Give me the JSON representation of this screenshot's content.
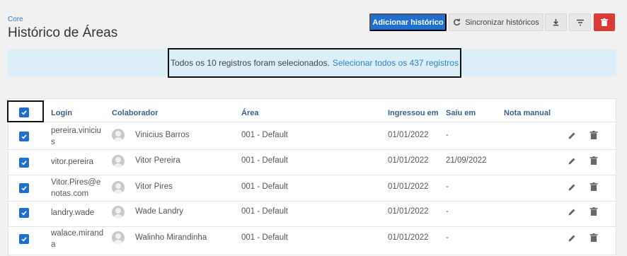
{
  "breadcrumb": "Core",
  "page_title": "Histórico de Áreas",
  "toolbar": {
    "add_label": "Adicionar histórico",
    "sync_label": "Sincronizar históricos"
  },
  "banner": {
    "message": "Todos os 10 registros foram selecionados.",
    "link": "Selecionar todos os 437 registros"
  },
  "table": {
    "headers": {
      "login": "Login",
      "colaborador": "Colaborador",
      "area": "Área",
      "ingressou": "Ingressou em",
      "saiu": "Saiu em",
      "nota": "Nota manual"
    },
    "rows": [
      {
        "login": "pereira.vinicius",
        "colaborador": "Vinicius Barros",
        "area": "001 - Default",
        "ingressou": "01/01/2022",
        "saiu": "-",
        "selected": true
      },
      {
        "login": "vitor.pereira",
        "colaborador": "Vitor Pereira",
        "area": "001 - Default",
        "ingressou": "01/01/2022",
        "saiu": "21/09/2022",
        "selected": true
      },
      {
        "login": "Vitor.Pires@enotas.com",
        "colaborador": "Vitor Pires",
        "area": "001 - Default",
        "ingressou": "01/01/2022",
        "saiu": "-",
        "selected": true
      },
      {
        "login": "landry.wade",
        "colaborador": "Wade Landry",
        "area": "001 - Default",
        "ingressou": "01/01/2022",
        "saiu": "-",
        "selected": true
      },
      {
        "login": "walace.miranda",
        "colaborador": "Walinho Mirandinha",
        "area": "001 - Default",
        "ingressou": "01/01/2022",
        "saiu": "-",
        "selected": true
      }
    ]
  },
  "colors": {
    "primary": "#1f6fd0",
    "danger": "#d93b36",
    "banner_bg": "#dceef7",
    "link": "#2a83d0"
  }
}
